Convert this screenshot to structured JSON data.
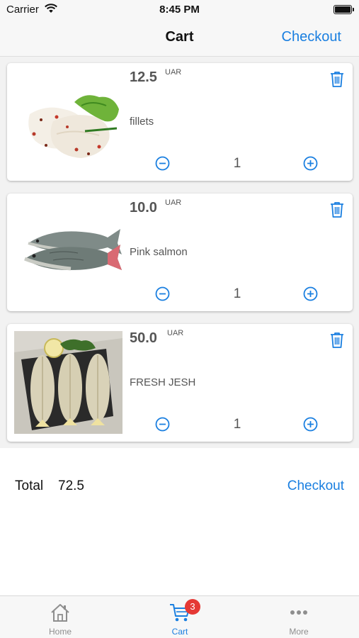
{
  "status_bar": {
    "carrier": "Carrier",
    "time": "8:45 PM"
  },
  "nav": {
    "title": "Cart",
    "checkout_label": "Checkout"
  },
  "cart_items": [
    {
      "price": "12.5",
      "currency": "UAR",
      "name": "fillets",
      "quantity": "1"
    },
    {
      "price": "10.0",
      "currency": "UAR",
      "name": "Pink salmon",
      "quantity": "1"
    },
    {
      "price": "50.0",
      "currency": "UAR",
      "name": "FRESH JESH",
      "quantity": "1"
    }
  ],
  "summary": {
    "total_label": "Total",
    "total_value": "72.5",
    "checkout_label": "Checkout"
  },
  "tab_bar": {
    "tabs": [
      {
        "label": "Home",
        "icon": "home-icon"
      },
      {
        "label": "Cart",
        "icon": "cart-icon",
        "badge": "3",
        "active": true
      },
      {
        "label": "More",
        "icon": "more-icon"
      }
    ]
  },
  "colors": {
    "accent": "#1a7fe0",
    "badge": "#e53935",
    "price_text": "#555555"
  }
}
